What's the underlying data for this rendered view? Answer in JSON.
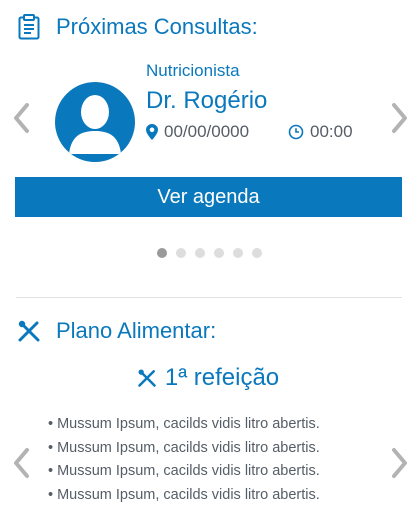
{
  "appointments": {
    "title": "Próximas Consultas:",
    "specialty": "Nutricionista",
    "doctor": "Dr. Rogério",
    "date": "00/00/0000",
    "time": "00:00",
    "button_label": "Ver agenda",
    "page_count": 6,
    "active_page": 1
  },
  "meal_plan": {
    "title": "Plano Alimentar:",
    "meal_title": "1ª refeição",
    "items": [
      "Mussum Ipsum, cacilds vidis litro abertis.",
      "Mussum Ipsum, cacilds vidis litro abertis.",
      "Mussum Ipsum, cacilds vidis litro abertis.",
      "Mussum Ipsum, cacilds vidis litro abertis."
    ]
  },
  "colors": {
    "accent": "#0a78bd",
    "text_gray": "#555d66",
    "chevron": "#b3b3b3",
    "dot": "#dddddd",
    "dot_active": "#9a9a9a"
  },
  "icons": [
    "clipboard-icon",
    "user-avatar-icon",
    "map-pin-icon",
    "clock-icon",
    "chevron-left-icon",
    "chevron-right-icon",
    "fork-knife-icon"
  ]
}
